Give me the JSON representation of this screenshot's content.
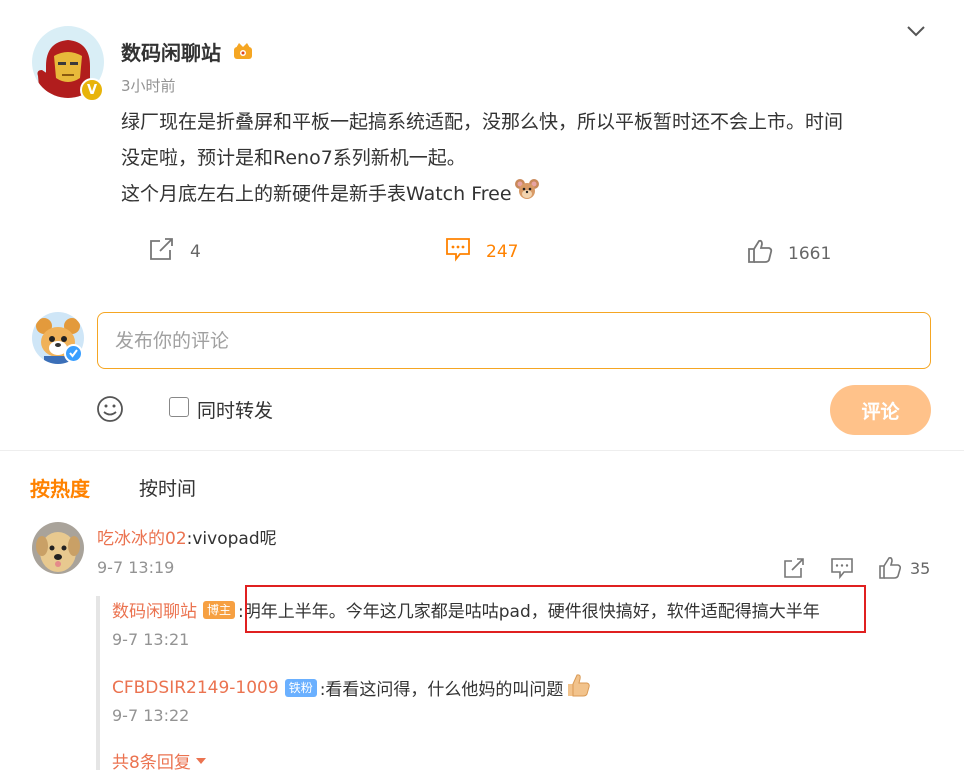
{
  "post": {
    "author": "数码闲聊站",
    "time": "3小时前",
    "lines": [
      "绿厂现在是折叠屏和平板一起搞系统适配，没那么快，所以平板暂时还不会上市。时间",
      "没定啦，预计是和Reno7系列新机一起。",
      "这个月底左右上的新硬件是新手表Watch Free"
    ],
    "repost_count": "4",
    "comment_count": "247",
    "like_count": "1661",
    "verified_badge": "V"
  },
  "composer": {
    "placeholder": "发布你的评论",
    "forward_label": "同时转发",
    "submit_label": "评论"
  },
  "sort_tabs": {
    "hot": "按热度",
    "time": "按时间"
  },
  "comment": {
    "user": "吃冰冰的02",
    "text": ":vivopad呢",
    "time": "9-7 13:19",
    "like_count": "35",
    "replies": [
      {
        "user": "数码闲聊站",
        "badge": "博主",
        "text": ":明年上半年。今年这几家都是咕咕pad，硬件很快搞好，软件适配得搞大半年",
        "time": "9-7 13:21"
      },
      {
        "user": "CFBDSIR2149-1009",
        "badge": "铁粉",
        "text": ":看看这问得，什么他妈的叫问题",
        "time": "9-7 13:22"
      }
    ],
    "more_replies": "共8条回复"
  },
  "colors": {
    "accent": "#ff8200",
    "username": "#eb7350",
    "muted": "#939393",
    "highlight": "#e02020",
    "submit_bg": "#ffc28a"
  }
}
